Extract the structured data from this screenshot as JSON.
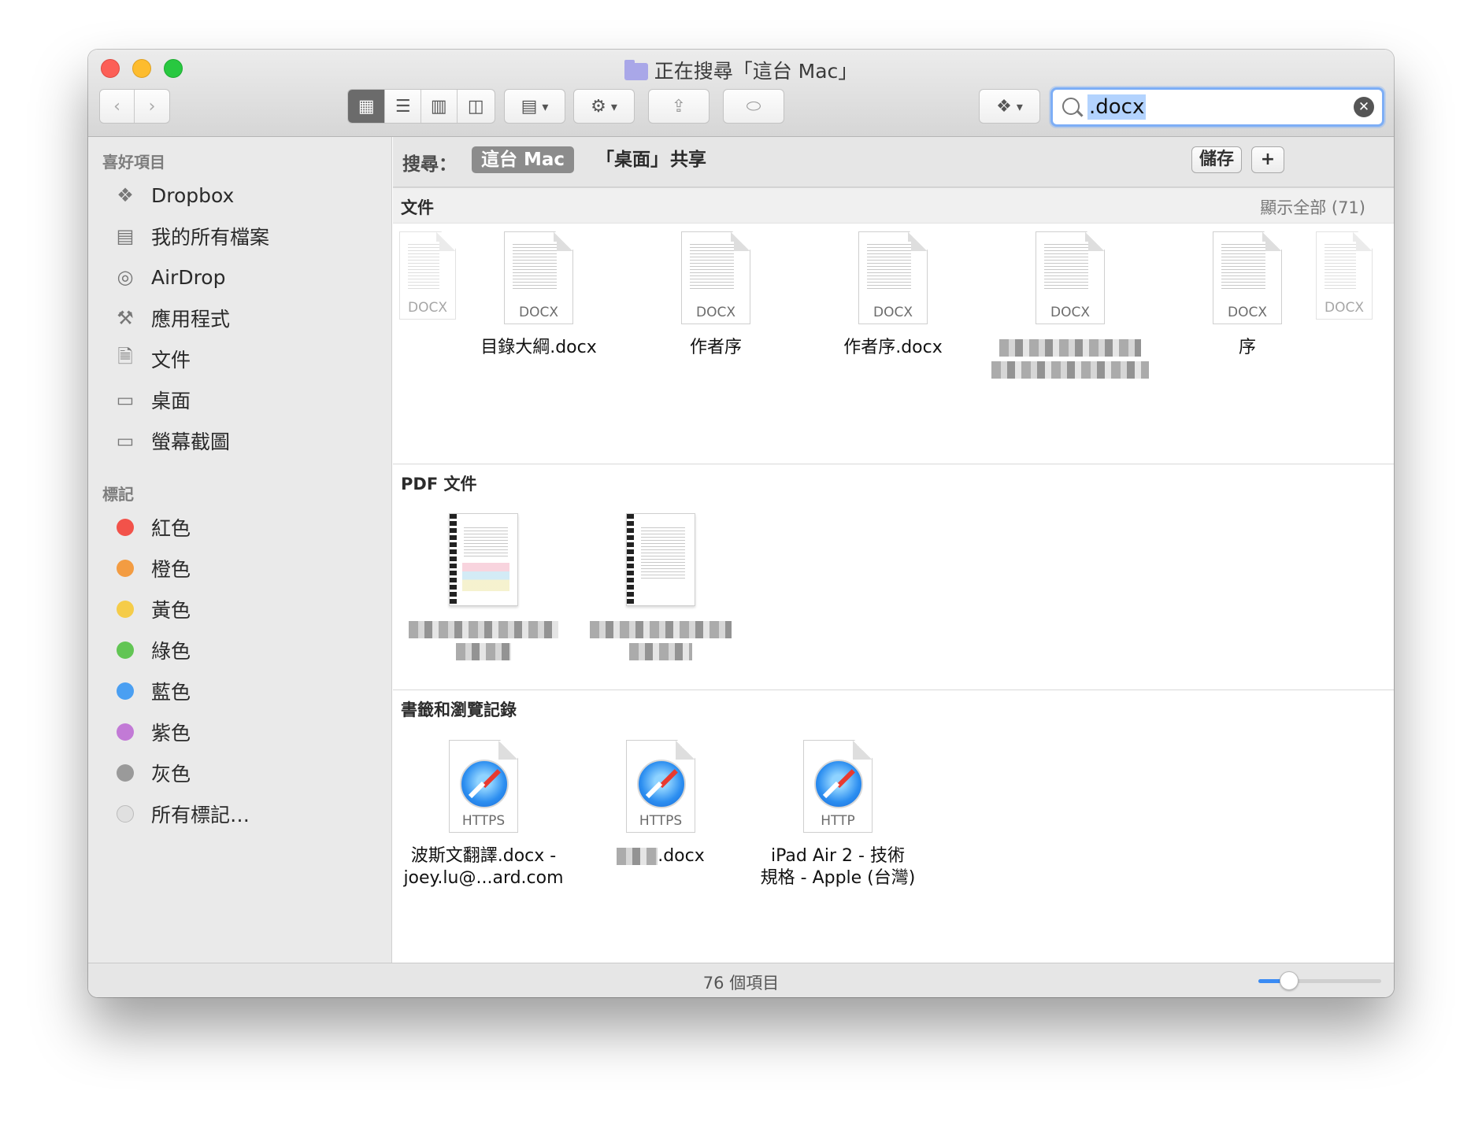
{
  "window": {
    "title": "正在搜尋「這台 Mac」"
  },
  "toolbar": {
    "back_icon": "chevron-left-icon",
    "forward_icon": "chevron-right-icon",
    "view_modes": [
      "icon-view",
      "list-view",
      "column-view",
      "coverflow-view"
    ],
    "active_view": "icon-view",
    "search_query": ".docx"
  },
  "sidebar": {
    "favorites_header": "喜好項目",
    "favorites": [
      {
        "label": "Dropbox",
        "icon": "dropbox-icon"
      },
      {
        "label": "我的所有檔案",
        "icon": "all-files-icon"
      },
      {
        "label": "AirDrop",
        "icon": "airdrop-icon"
      },
      {
        "label": "應用程式",
        "icon": "applications-icon"
      },
      {
        "label": "文件",
        "icon": "documents-icon"
      },
      {
        "label": "桌面",
        "icon": "desktop-icon"
      },
      {
        "label": "螢幕截圖",
        "icon": "folder-icon"
      }
    ],
    "tags_header": "標記",
    "tags": [
      {
        "label": "紅色",
        "color": "#f2524a"
      },
      {
        "label": "橙色",
        "color": "#f39c42"
      },
      {
        "label": "黃色",
        "color": "#f5cc49"
      },
      {
        "label": "綠色",
        "color": "#62c554"
      },
      {
        "label": "藍色",
        "color": "#4a9ff2"
      },
      {
        "label": "紫色",
        "color": "#c27ad6"
      },
      {
        "label": "灰色",
        "color": "#9a9a9a"
      },
      {
        "label": "所有標記…",
        "color": "#e0e0e0"
      }
    ]
  },
  "scope": {
    "label": "搜尋：",
    "options": [
      "這台 Mac",
      "「桌面」",
      "共享"
    ],
    "active": "這台 Mac",
    "save_label": "儲存",
    "add_label": "+"
  },
  "sections": {
    "documents": {
      "title": "文件",
      "show_all": "顯示全部 (71)",
      "files": [
        {
          "name": "目錄大綱.docx",
          "ext": "DOCX"
        },
        {
          "name": "作者序",
          "ext": "DOCX"
        },
        {
          "name": "作者序.docx",
          "ext": "DOCX"
        },
        {
          "name": "",
          "ext": "DOCX"
        },
        {
          "name": "序",
          "ext": "DOCX"
        }
      ],
      "stack_ext": "DOCX"
    },
    "pdf": {
      "title": "PDF 文件"
    },
    "bookmarks": {
      "title": "書籤和瀏覽記錄",
      "items": [
        {
          "name_line1": "波斯文翻譯.docx -",
          "name_line2": "joey.lu@...ard.com",
          "ext": "HTTPS"
        },
        {
          "name_line1": ".docx",
          "name_line2": "",
          "ext": "HTTPS"
        },
        {
          "name_line1": "iPad Air 2 - 技術",
          "name_line2": "規格 - Apple (台灣)",
          "ext": "HTTP"
        }
      ]
    }
  },
  "status": {
    "item_count": "76 個項目",
    "icon_size_level": 0.25
  }
}
